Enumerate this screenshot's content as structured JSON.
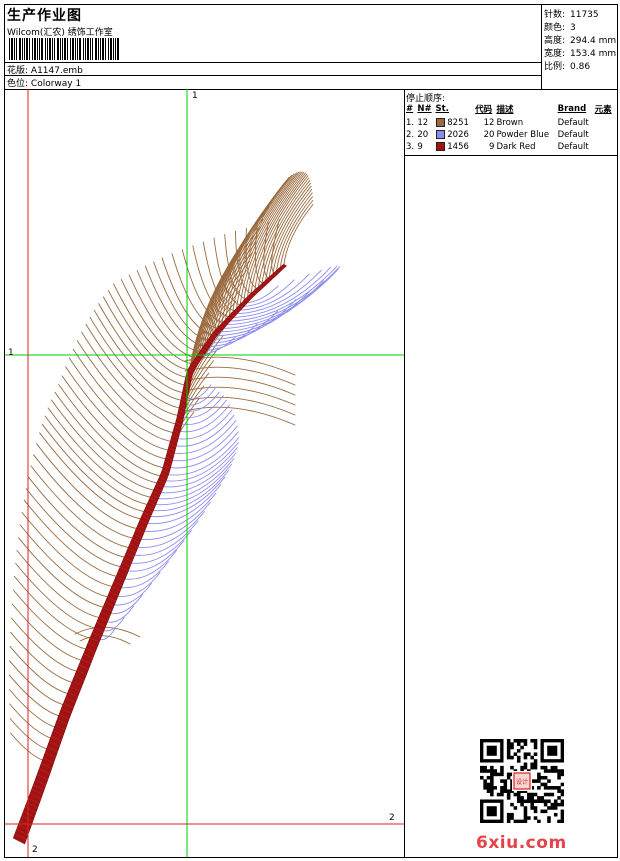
{
  "header": {
    "title": "生产作业图",
    "subtitle": "Wilcom(汇农) 绣饰工作室",
    "design_label": "花版:",
    "design_value": "A1147.emb",
    "colorway_label": "色位:",
    "colorway_value": "Colorway 1"
  },
  "stats": [
    {
      "label": "针数:",
      "value": "11735"
    },
    {
      "label": "颜色:",
      "value": "3"
    },
    {
      "label": "高度:",
      "value": "294.4 mm"
    },
    {
      "label": "宽度:",
      "value": "153.4 mm"
    },
    {
      "label": "比例:",
      "value": "0.86"
    }
  ],
  "colors_panel": {
    "title": "停止顺序:",
    "headers": [
      "#",
      "N#",
      "St.",
      "代码",
      "描述",
      "Brand",
      "元素"
    ],
    "rows": [
      {
        "index": "1.",
        "needle": "12",
        "color": "#9a6a3e",
        "stitches": "8251",
        "code": "12",
        "description": "Brown",
        "brand": "Default"
      },
      {
        "index": "2.",
        "needle": "20",
        "color": "#8c8cf0",
        "stitches": "2026",
        "code": "20",
        "description": "Powder Blue",
        "brand": "Default"
      },
      {
        "index": "3.",
        "needle": "9",
        "color": "#a11212",
        "stitches": "1456",
        "code": "9",
        "description": "Dark Red",
        "brand": "Default"
      }
    ]
  },
  "guides": {
    "v1_label": "1",
    "h1_label": "1",
    "v2_label": "2",
    "h2_label": "2",
    "green": "#00d000",
    "red": "#dd2222"
  },
  "watermark": "6xiu.com",
  "stamp_text": "设计"
}
